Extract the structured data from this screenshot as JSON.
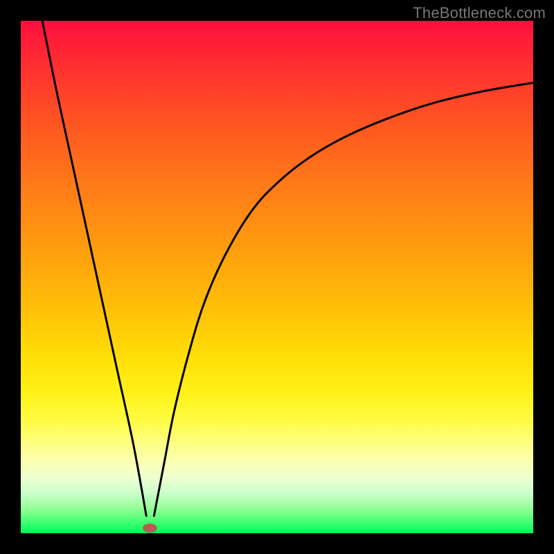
{
  "watermark": "TheBottleneck.com",
  "chart_data": {
    "type": "line",
    "title": "",
    "xlabel": "",
    "ylabel": "",
    "xlim": [
      0,
      1
    ],
    "ylim": [
      0,
      1
    ],
    "grid": false,
    "legend": false,
    "background_gradient": {
      "direction": "vertical",
      "stops": [
        {
          "pos": 0.0,
          "color": "#ff0d3f"
        },
        {
          "pos": 0.2,
          "color": "#ff5522"
        },
        {
          "pos": 0.44,
          "color": "#ff9c0e"
        },
        {
          "pos": 0.66,
          "color": "#ffe008"
        },
        {
          "pos": 0.82,
          "color": "#feff7e"
        },
        {
          "pos": 0.92,
          "color": "#ceffce"
        },
        {
          "pos": 1.0,
          "color": "#0aec5a"
        }
      ]
    },
    "series": [
      {
        "name": "left-branch",
        "x": [
          0.042,
          0.07,
          0.1,
          0.13,
          0.16,
          0.19,
          0.22,
          0.245
        ],
        "y": [
          1.0,
          0.862,
          0.724,
          0.586,
          0.448,
          0.31,
          0.172,
          0.034
        ]
      },
      {
        "name": "right-branch",
        "x": [
          0.26,
          0.28,
          0.3,
          0.33,
          0.36,
          0.4,
          0.45,
          0.5,
          0.56,
          0.63,
          0.71,
          0.8,
          0.9,
          1.0
        ],
        "y": [
          0.034,
          0.138,
          0.241,
          0.359,
          0.455,
          0.545,
          0.628,
          0.683,
          0.731,
          0.772,
          0.807,
          0.838,
          0.862,
          0.879
        ]
      }
    ],
    "marker": {
      "name": "minimum-marker",
      "x": 0.252,
      "y": 0.01,
      "color": "#bb5a4f",
      "rx": 0.014,
      "ry": 0.009
    }
  }
}
